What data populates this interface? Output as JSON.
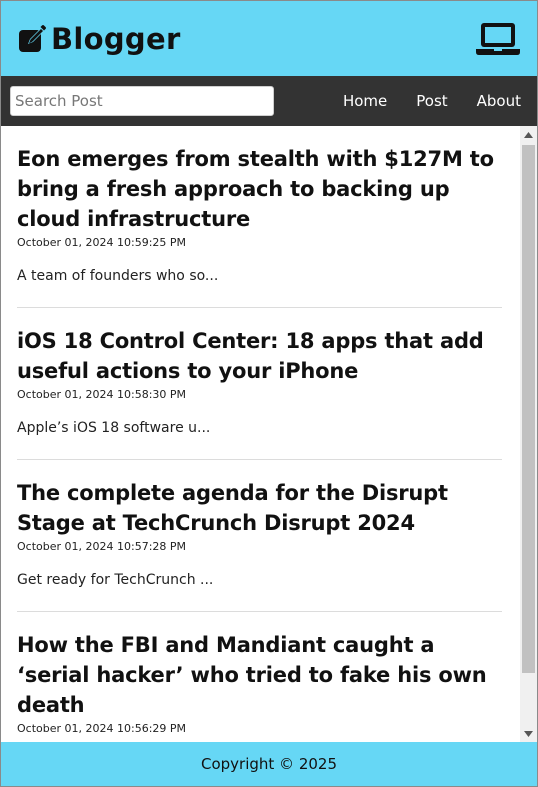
{
  "header": {
    "brand_icon": "pencil-square-icon",
    "title": "Blogger",
    "device_icon": "laptop-icon"
  },
  "nav": {
    "search_placeholder": "Search Post",
    "search_value": "",
    "links": [
      "Home",
      "Post",
      "About"
    ]
  },
  "posts": [
    {
      "title": "Eon emerges from stealth with $127M to bring a fresh approach to backing up cloud infrastructure",
      "date": "October 01, 2024 10:59:25 PM",
      "excerpt": "A team of founders who so..."
    },
    {
      "title": "iOS 18 Control Center: 18 apps that add useful actions to your iPhone",
      "date": "October 01, 2024 10:58:30 PM",
      "excerpt": "Apple’s iOS 18 software u..."
    },
    {
      "title": "The complete agenda for the Disrupt Stage at TechCrunch Disrupt 2024",
      "date": "October 01, 2024 10:57:28 PM",
      "excerpt": "Get ready for TechCrunch ..."
    },
    {
      "title": "How the FBI and Mandiant caught a ‘serial hacker’ who tried to fake his own death",
      "date": "October 01, 2024 10:56:29 PM",
      "excerpt": ""
    }
  ],
  "footer": {
    "copyright": "Copyright © 2025"
  },
  "colors": {
    "header_bg": "#66d7f5",
    "nav_bg": "#333333",
    "footer_bg": "#66d7f5"
  }
}
